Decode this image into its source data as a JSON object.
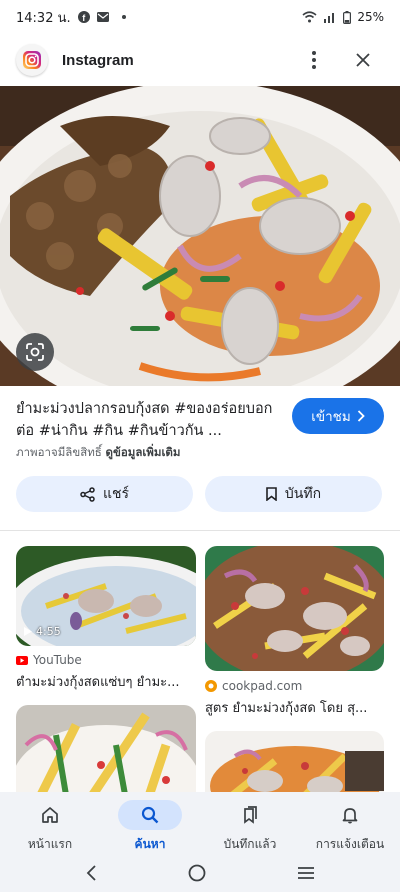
{
  "status_bar": {
    "time": "14:32 น.",
    "battery": "25%"
  },
  "app": {
    "title": "Instagram"
  },
  "post": {
    "caption": "ยำมะม่วงปลากรอบกุ้งสด #ของอร่อยบอกต่อ #น่ากิน #กิน #กินข้าวกัน ...",
    "copyright_note": "ภาพอาจมีลิขสิทธิ์",
    "learn_more": "ดูข้อมูลเพิ่มเติม",
    "visit_label": "เข้าชม",
    "share_label": "แชร์",
    "save_label": "บันทึก"
  },
  "results": [
    {
      "source": "YouTube",
      "title": "ตำมะม่วงกุ้งสดแซ่บๆ ยำมะ...",
      "duration": "4:55",
      "source_icon": "youtube-icon"
    },
    {
      "source": "cookpad.com",
      "title": "สูตร ยำมะม่วงกุ้งสด โดย สุ...",
      "source_icon": "cookpad-icon"
    }
  ],
  "bottom_nav": {
    "items": [
      {
        "label": "หน้าแรก",
        "icon": "home-icon",
        "active": false
      },
      {
        "label": "ค้นหา",
        "icon": "search-icon",
        "active": true
      },
      {
        "label": "บันทึกแล้ว",
        "icon": "bookmarks-icon",
        "active": false
      },
      {
        "label": "การแจ้งเตือน",
        "icon": "bell-icon",
        "active": false
      }
    ]
  },
  "colors": {
    "accent": "#1a73e8",
    "pill": "#e8f0fe",
    "nav_bg": "#f1f3f7",
    "nav_active": "#d3e3fd",
    "youtube": "#ff0000",
    "cookpad": "#f39800"
  }
}
